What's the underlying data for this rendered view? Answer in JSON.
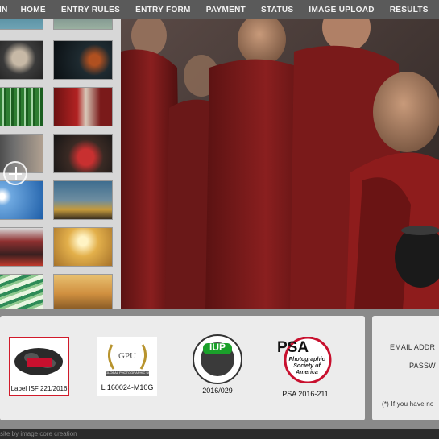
{
  "nav": {
    "items": [
      "IN",
      "HOME",
      "ENTRY RULES",
      "ENTRY FORM",
      "PAYMENT",
      "STATUS",
      "IMAGE UPLOAD",
      "RESULTS"
    ]
  },
  "gallery": {
    "thumbnails": [
      "portrait-thumb",
      "bicycles-thumb",
      "field-workers-thumb",
      "monks-thumb",
      "child-window-thumb",
      "monks-reading-thumb",
      "birds-sea-thumb",
      "fishing-boat-thumb",
      "ox-race-thumb",
      "desert-thumb",
      "green-water-thumb",
      "sunset-river-thumb"
    ]
  },
  "patrons": {
    "fiap": {
      "caption": "Label ISF 221/2016"
    },
    "gpu": {
      "caption": "L 160024-M10G",
      "small1": "GPU",
      "small2": "GLOBAL PHOTOGRAPHIC UNION"
    },
    "iup": {
      "caption": "2016/029",
      "title": "IUP"
    },
    "psa": {
      "caption": "PSA 2016-211",
      "title": "PSA",
      "sub1": "Photographic",
      "sub2": "Society of",
      "sub3": "America"
    }
  },
  "login": {
    "email_label": "EMAIL ADDR",
    "password_label": "PASSW",
    "note": "(*) If you have no"
  },
  "footer": {
    "text": "site by image core creation"
  },
  "colors": {
    "accent_red": "#c8102e",
    "nav_bg": "#5a5a5a",
    "panel_bg": "#ececec"
  }
}
